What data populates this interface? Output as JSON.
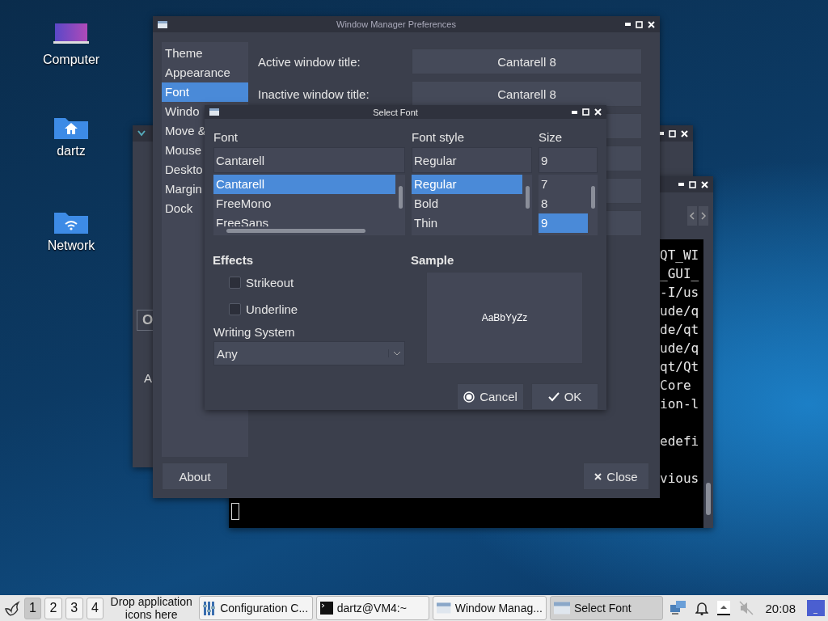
{
  "desktop_icons": [
    {
      "label": "Computer",
      "kind": "computer"
    },
    {
      "label": "dartz",
      "kind": "home"
    },
    {
      "label": "Network",
      "kind": "network"
    }
  ],
  "back_window": {
    "texts": [
      "O",
      "A"
    ]
  },
  "terminal": {
    "blocks": [
      [
        "QT_WI",
        "_GUI_",
        "-I/us",
        "ude/q",
        "de/qt",
        "ude/q",
        "qt/Qt",
        "Core",
        "ion-l"
      ],
      [
        "edefi"
      ],
      [
        "vious"
      ]
    ]
  },
  "preferences": {
    "title": "Window Manager Preferences",
    "sidebar": [
      {
        "label": "Theme",
        "selected": false
      },
      {
        "label": "Appearance",
        "selected": false
      },
      {
        "label": "Font",
        "selected": true
      },
      {
        "label": "Windo",
        "selected": false
      },
      {
        "label": "Move &",
        "selected": false
      },
      {
        "label": "Mouse",
        "selected": false
      },
      {
        "label": "Deskto",
        "selected": false
      },
      {
        "label": "Margin",
        "selected": false
      },
      {
        "label": "Dock",
        "selected": false
      }
    ],
    "rows": [
      {
        "label": "Active window title:",
        "value": "Cantarell 8"
      },
      {
        "label": "Inactive window title:",
        "value": "Cantarell 8"
      }
    ],
    "about": "About",
    "close": "Close"
  },
  "dialog": {
    "title": "Select Font",
    "columns": [
      {
        "label": "Font",
        "value": "Cantarell",
        "items": [
          {
            "label": "Cantarell",
            "selected": true
          },
          {
            "label": "FreeMono",
            "selected": false
          },
          {
            "label": "FreeSans",
            "selected": false
          }
        ]
      },
      {
        "label": "Font style",
        "value": "Regular",
        "items": [
          {
            "label": "Regular",
            "selected": true
          },
          {
            "label": "Bold",
            "selected": false
          },
          {
            "label": "Thin",
            "selected": false
          }
        ]
      },
      {
        "label": "Size",
        "value": "9",
        "items": [
          {
            "label": "7",
            "selected": false
          },
          {
            "label": "8",
            "selected": false
          },
          {
            "label": "9",
            "selected": true
          }
        ]
      }
    ],
    "effects": {
      "label": "Effects",
      "checks": [
        {
          "label": "Strikeout",
          "checked": false
        },
        {
          "label": "Underline",
          "checked": false
        }
      ]
    },
    "writing_system": {
      "label": "Writing System",
      "value": "Any"
    },
    "sample": {
      "label": "Sample",
      "text": "AaBbYyZz"
    },
    "buttons": [
      {
        "label": "Cancel",
        "kind": "cancel"
      },
      {
        "label": "OK",
        "kind": "ok"
      }
    ]
  },
  "taskbar": {
    "workspaces": [
      {
        "label": "1",
        "selected": true
      },
      {
        "label": "2",
        "selected": false
      },
      {
        "label": "3",
        "selected": false
      },
      {
        "label": "4",
        "selected": false
      }
    ],
    "drop_hint": "Drop application icons here",
    "tasks": [
      {
        "label": "Configuration C...",
        "kind": "config",
        "selected": false
      },
      {
        "label": "dartz@VM4:~",
        "kind": "terminal",
        "selected": false
      },
      {
        "label": "Window Manag...",
        "kind": "window",
        "selected": false
      },
      {
        "label": "Select Font",
        "kind": "window",
        "selected": true
      }
    ],
    "clock": "20:08"
  }
}
